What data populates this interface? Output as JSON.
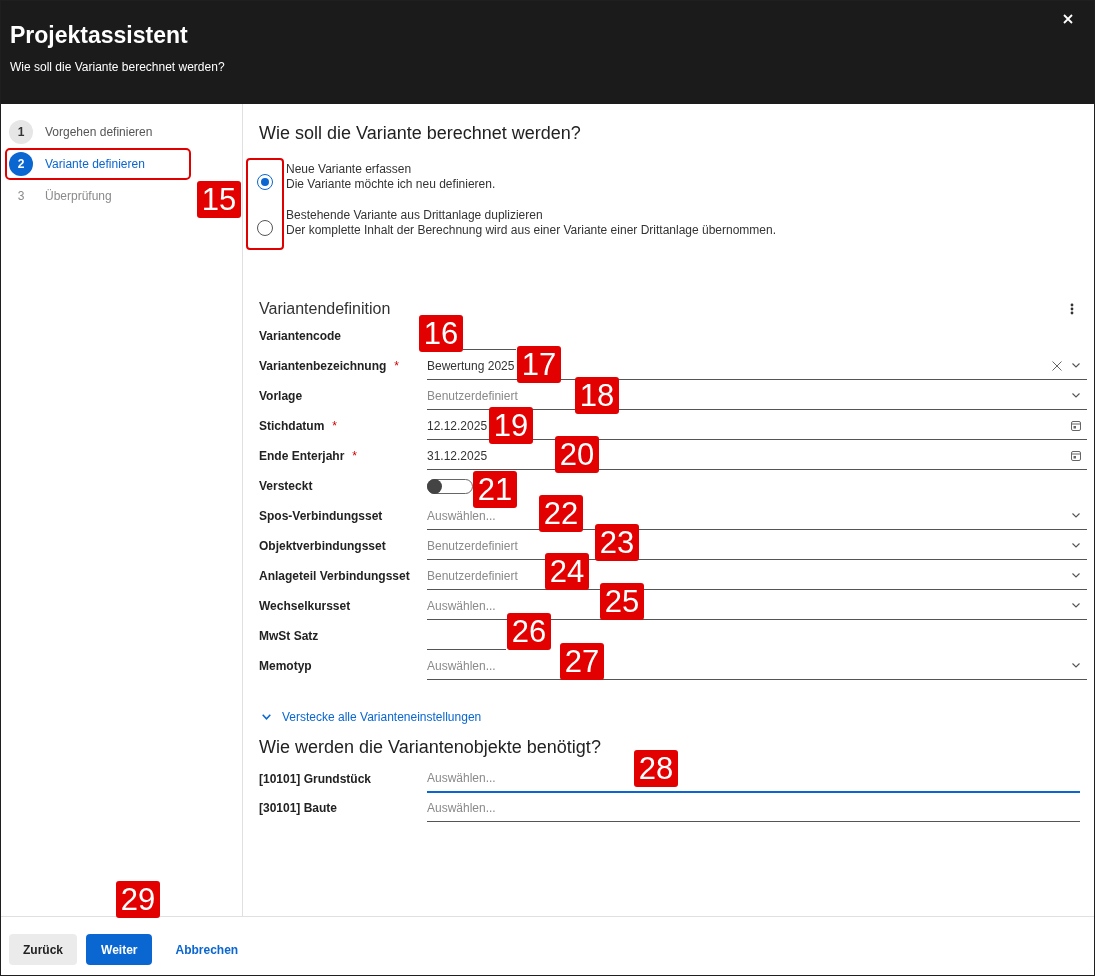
{
  "window": {
    "title": "Projektassistent",
    "subtitle": "Wie soll die Variante berechnet werden?"
  },
  "steps": [
    {
      "number": "1",
      "label": "Vorgehen definieren",
      "completed": true,
      "selected": false,
      "outlined": false
    },
    {
      "number": "2",
      "label": "Variante definieren",
      "completed": false,
      "selected": true,
      "outlined": true
    },
    {
      "number": "3",
      "label": "Überprüfung",
      "completed": false,
      "selected": false,
      "outlined": false
    }
  ],
  "calculation": {
    "heading": "Wie soll die Variante berechnet werden?",
    "outlined": true,
    "options": [
      {
        "title": "Neue Variante erfassen",
        "description": "Die Variante möchte ich neu definieren.",
        "selected": true
      },
      {
        "title": "Bestehende Variante aus Drittanlage duplizieren",
        "description": "Der komplette Inhalt der Berechnung wird aus einer Variante einer Drittanlage übernommen.",
        "selected": false
      }
    ]
  },
  "variant_definition": {
    "title": "Variantendefinition",
    "required_mark": "*",
    "fields": [
      {
        "label": "Variantencode",
        "kind": "text"
      },
      {
        "label": "Variantenbezeichnung",
        "kind": "combo",
        "required": true,
        "value": "Bewertung 2025"
      },
      {
        "label": "Vorlage",
        "kind": "select",
        "placeholder": "Benutzerdefiniert"
      },
      {
        "label": "Stichdatum",
        "kind": "date",
        "required": true,
        "value": "12.12.2025"
      },
      {
        "label": "Ende Enterjahr",
        "kind": "date",
        "required": true,
        "value": "31.12.2025"
      },
      {
        "label": "Versteckt",
        "kind": "toggle",
        "on": false
      },
      {
        "label": "Spos-Verbindungsset",
        "kind": "select",
        "placeholder": "Auswählen..."
      },
      {
        "label": "Objektverbindungsset",
        "kind": "select",
        "placeholder": "Benutzerdefiniert"
      },
      {
        "label": "Anlageteil Verbindungsset",
        "kind": "select",
        "placeholder": "Benutzerdefiniert"
      },
      {
        "label": "Wechselkursset",
        "kind": "select",
        "placeholder": "Auswählen..."
      },
      {
        "label": "MwSt Satz",
        "kind": "text"
      },
      {
        "label": "Memotyp",
        "kind": "select",
        "placeholder": "Auswählen..."
      }
    ],
    "collapse_link": "Verstecke alle Varianteneinstellungen"
  },
  "objects": {
    "heading": "Wie werden die Variantenobjekte benötigt?",
    "fields": [
      {
        "label": "[10101] Grundstück",
        "placeholder": "Auswählen...",
        "focused": true
      },
      {
        "label": "[30101] Baute",
        "placeholder": "Auswählen...",
        "focused": false
      }
    ]
  },
  "footer": {
    "buttons": [
      {
        "label": "Zurück",
        "kind": "secondary"
      },
      {
        "label": "Weiter",
        "kind": "primary"
      },
      {
        "label": "Abbrechen",
        "kind": "link"
      }
    ]
  },
  "callouts": [
    "15",
    "16",
    "17",
    "18",
    "19",
    "20",
    "21",
    "22",
    "23",
    "24",
    "25",
    "26",
    "27",
    "28",
    "29"
  ]
}
